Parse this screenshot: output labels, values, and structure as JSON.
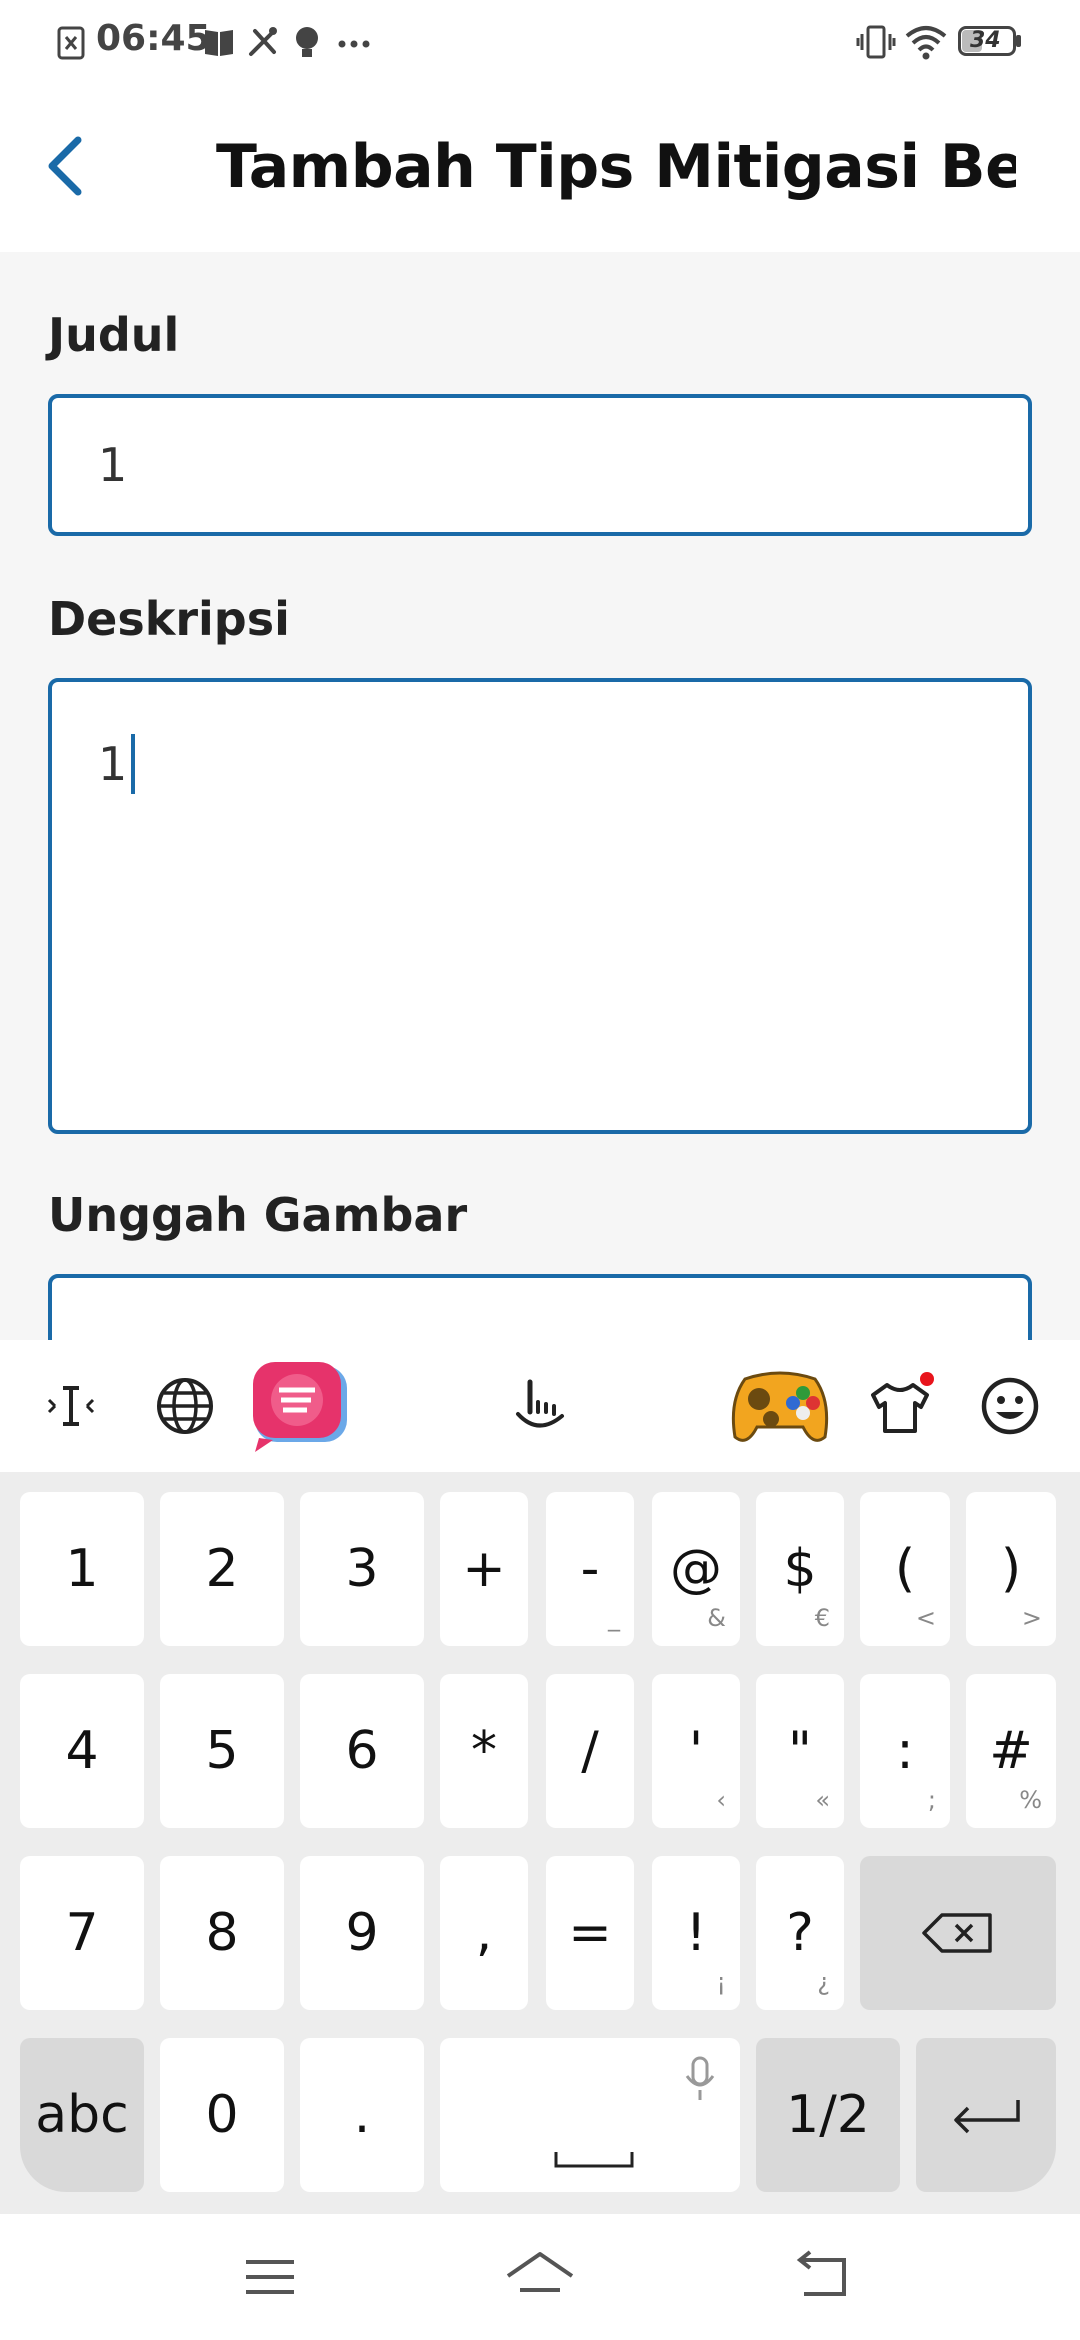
{
  "status_bar": {
    "time": "06:45",
    "battery": "34",
    "icons": [
      "notification-x-icon",
      "book-icon",
      "tools-icon",
      "bulb-icon",
      "more-dots-icon",
      "vibrate-icon",
      "wifi-icon",
      "battery-icon"
    ]
  },
  "header": {
    "title": "Tambah Tips Mitigasi Be...",
    "back_icon": "chevron-left-icon"
  },
  "form": {
    "judul_label": "Judul",
    "judul_value": "1",
    "deskripsi_label": "Deskripsi",
    "deskripsi_value": "1",
    "unggah_label": "Unggah Gambar"
  },
  "keyboard_toolbar": {
    "icons": [
      "text-cursor-icon",
      "globe-icon",
      "sticker-app-icon",
      "gesture-hand-icon",
      "gamepad-icon",
      "theme-shirt-icon",
      "emoji-icon"
    ]
  },
  "keyboard": {
    "rows": [
      [
        {
          "k": "1"
        },
        {
          "k": "2"
        },
        {
          "k": "3"
        },
        {
          "k": "+"
        },
        {
          "k": "-",
          "s": "_"
        },
        {
          "k": "@",
          "s": "&"
        },
        {
          "k": "$",
          "s": "€"
        },
        {
          "k": "(",
          "s": "<"
        },
        {
          "k": ")",
          "s": ">"
        }
      ],
      [
        {
          "k": "4"
        },
        {
          "k": "5"
        },
        {
          "k": "6"
        },
        {
          "k": "*"
        },
        {
          "k": "/"
        },
        {
          "k": "'",
          "s": "‹"
        },
        {
          "k": "\"",
          "s": "«"
        },
        {
          "k": ":",
          "s": ";"
        },
        {
          "k": "#",
          "s": "%"
        }
      ],
      [
        {
          "k": "7"
        },
        {
          "k": "8"
        },
        {
          "k": "9"
        },
        {
          "k": ","
        },
        {
          "k": "="
        },
        {
          "k": "!",
          "s": "¡"
        },
        {
          "k": "?",
          "s": "¿"
        }
      ],
      [
        {
          "k": "abc"
        },
        {
          "k": "0"
        },
        {
          "k": "."
        },
        {
          "k": "1/2"
        }
      ]
    ]
  },
  "navbar": {
    "icons": [
      "menu-icon",
      "home-icon",
      "back-nav-icon"
    ]
  },
  "colors": {
    "accent": "#1a6aa8",
    "form_bg": "#f6f6f6",
    "keyboard_bg": "#ededed"
  }
}
